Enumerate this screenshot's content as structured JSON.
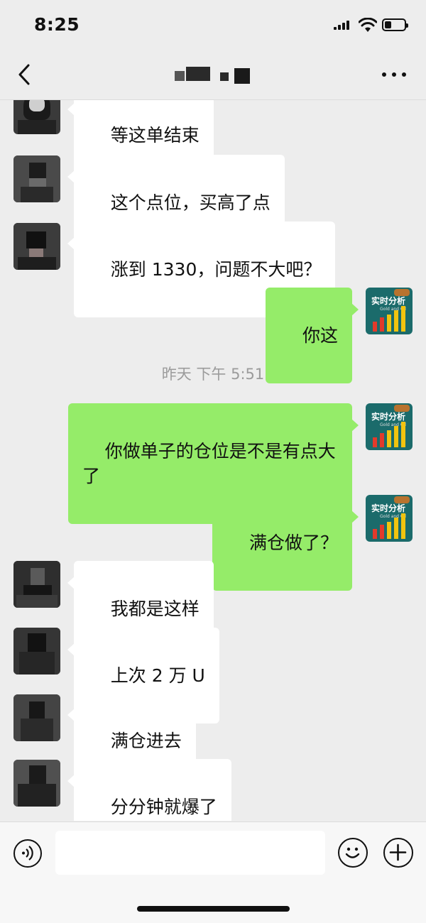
{
  "status_bar": {
    "time": "8:25"
  },
  "header": {
    "title": ""
  },
  "messages": [
    {
      "from": "other",
      "text": "等这单结束"
    },
    {
      "from": "other",
      "text": "这个点位，买高了点"
    },
    {
      "from": "other",
      "text": "涨到 1330，问题不大吧？"
    },
    {
      "from": "me",
      "text": "你这"
    },
    {
      "type": "timestamp",
      "text": "昨天 下午 5:51"
    },
    {
      "from": "me",
      "text": "你做单子的仓位是不是有点大\n了"
    },
    {
      "from": "me",
      "text": "满仓做了？"
    },
    {
      "from": "other",
      "text": "我都是这样"
    },
    {
      "from": "other",
      "text": "上次 2 万 U"
    },
    {
      "from": "other",
      "text": "满仓进去"
    },
    {
      "from": "other",
      "text": "分分钟就爆了"
    }
  ],
  "my_avatar": {
    "text": "实时分析",
    "subtext": "Gold and Oil"
  },
  "input_bar": {
    "placeholder": ""
  },
  "colors": {
    "my_bubble": "#95ec69",
    "other_bubble": "#ffffff",
    "background": "#ededed"
  },
  "icons": [
    "back-chevron-icon",
    "more-dots-icon",
    "voice-icon",
    "emoji-icon",
    "plus-icon"
  ]
}
